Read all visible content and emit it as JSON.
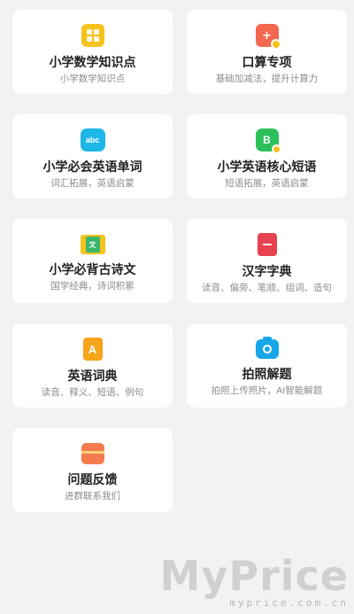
{
  "cards": [
    {
      "title": "小学数学知识点",
      "subtitle": "小学数学知识点",
      "icon": "math-calculator-icon"
    },
    {
      "title": "口算专项",
      "subtitle": "基础加减法，提升计算力",
      "icon": "oral-math-icon"
    },
    {
      "title": "小学必会英语单词",
      "subtitle": "词汇拓展，英语启蒙",
      "icon": "abc-word-icon",
      "icon_text": "abc"
    },
    {
      "title": "小学英语核心短语",
      "subtitle": "短语拓展，英语启蒙",
      "icon": "phrase-b-icon",
      "icon_text": "B"
    },
    {
      "title": "小学必背古诗文",
      "subtitle": "国学经典，诗词积累",
      "icon": "poetry-scroll-icon",
      "icon_text": "文"
    },
    {
      "title": "汉字字典",
      "subtitle": "读音、偏旁、笔顺、组词、造句",
      "icon": "hanzi-dictionary-icon"
    },
    {
      "title": "英语词典",
      "subtitle": "读音、释义、短语、例句",
      "icon": "english-dictionary-icon",
      "icon_text": "A"
    },
    {
      "title": "拍照解题",
      "subtitle": "拍照上传照片，AI智能解题",
      "icon": "camera-icon"
    },
    {
      "title": "问题反馈",
      "subtitle": "进群联系我们",
      "icon": "feedback-icon"
    }
  ],
  "watermark": {
    "brand": "MyPrice",
    "url": "myprice.com.cn"
  }
}
